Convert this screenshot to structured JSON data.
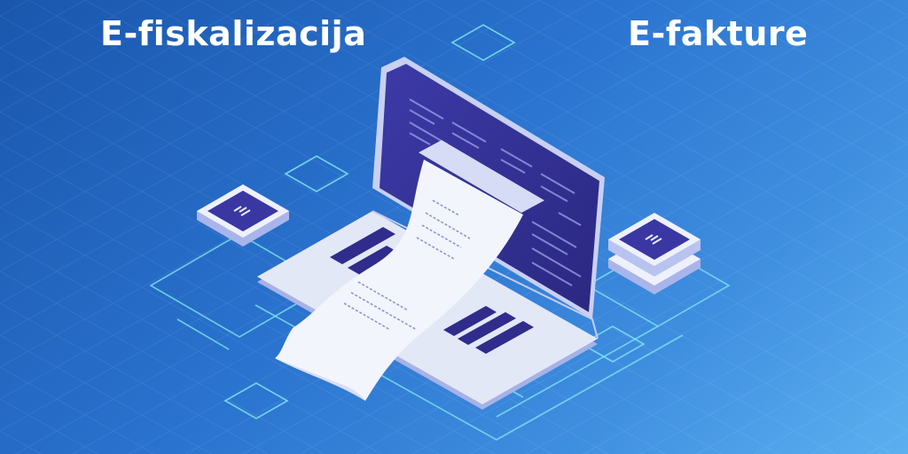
{
  "headings": {
    "left": "E-fiskalizacija",
    "right": "E-fakture"
  },
  "colors": {
    "background_start": "#1a56ad",
    "background_end": "#5cb0f0",
    "screen": "#35329a",
    "laptop_body": "#e3e8f7",
    "receipt": "#f3f5fd",
    "outline_cyan": "#7fe6ee",
    "heading_text": "#ffffff"
  },
  "icons": {
    "left_tile": "logo-tile-icon",
    "right_tile": "stacked-logo-tile-icon",
    "device": "laptop-icon",
    "document": "receipt-icon"
  }
}
